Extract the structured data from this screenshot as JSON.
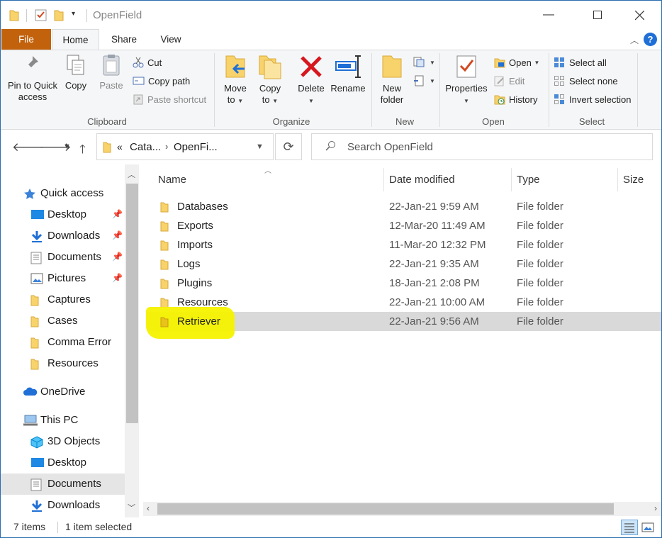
{
  "window": {
    "title": "OpenField",
    "controls": [
      "minimize-icon",
      "maximize-icon",
      "close-icon"
    ]
  },
  "quick_access_toolbar": [
    "folder-icon",
    "properties-check-icon",
    "new-folder-icon",
    "customize-chevron-icon"
  ],
  "ribbon_tabs": {
    "file": "File",
    "home": "Home",
    "share": "Share",
    "view": "View",
    "help": "?"
  },
  "ribbon": {
    "clipboard": {
      "label": "Clipboard",
      "pin_l1": "Pin to Quick",
      "pin_l2": "access",
      "copy": "Copy",
      "paste": "Paste",
      "cut": "Cut",
      "copy_path": "Copy path",
      "paste_shortcut": "Paste shortcut"
    },
    "organize": {
      "label": "Organize",
      "move_l1": "Move",
      "move_l2": "to",
      "copy_l1": "Copy",
      "copy_l2": "to",
      "delete": "Delete",
      "rename": "Rename"
    },
    "new": {
      "label": "New",
      "folder_l1": "New",
      "folder_l2": "folder"
    },
    "open": {
      "label": "Open",
      "properties": "Properties",
      "open": "Open",
      "edit": "Edit",
      "history": "History"
    },
    "select": {
      "label": "Select",
      "all": "Select all",
      "none": "Select none",
      "invert": "Invert selection"
    }
  },
  "address": {
    "crumb_prefix": "«",
    "crumb1": "Cata...",
    "crumb2": "OpenFi...",
    "search_placeholder": "Search OpenField"
  },
  "nav": {
    "quick_access": "Quick access",
    "items": [
      {
        "label": "Desktop"
      },
      {
        "label": "Downloads"
      },
      {
        "label": "Documents"
      },
      {
        "label": "Pictures"
      },
      {
        "label": "Captures"
      },
      {
        "label": "Cases"
      },
      {
        "label": "Comma Error"
      },
      {
        "label": "Resources"
      }
    ],
    "onedrive": "OneDrive",
    "this_pc": "This PC",
    "pc_items": [
      {
        "label": "3D Objects"
      },
      {
        "label": "Desktop"
      },
      {
        "label": "Documents"
      },
      {
        "label": "Downloads"
      }
    ]
  },
  "columns": {
    "name": "Name",
    "date": "Date modified",
    "type": "Type",
    "size": "Size"
  },
  "files": [
    {
      "name": "Databases",
      "date": "22-Jan-21 9:59 AM",
      "type": "File folder"
    },
    {
      "name": "Exports",
      "date": "12-Mar-20 11:49 AM",
      "type": "File folder"
    },
    {
      "name": "Imports",
      "date": "11-Mar-20 12:32 PM",
      "type": "File folder"
    },
    {
      "name": "Logs",
      "date": "22-Jan-21 9:35 AM",
      "type": "File folder"
    },
    {
      "name": "Plugins",
      "date": "18-Jan-21 2:08 PM",
      "type": "File folder"
    },
    {
      "name": "Resources",
      "date": "22-Jan-21 10:00 AM",
      "type": "File folder"
    },
    {
      "name": "Retriever",
      "date": "22-Jan-21 9:56 AM",
      "type": "File folder"
    }
  ],
  "status": {
    "count": "7 items",
    "selected": "1 item selected"
  },
  "colors": {
    "file_tab": "#c2620c",
    "highlight": "#f5f200",
    "selection": "#d9d9d9",
    "accent": "#1f6fd6",
    "folder": "#f8d36b"
  }
}
